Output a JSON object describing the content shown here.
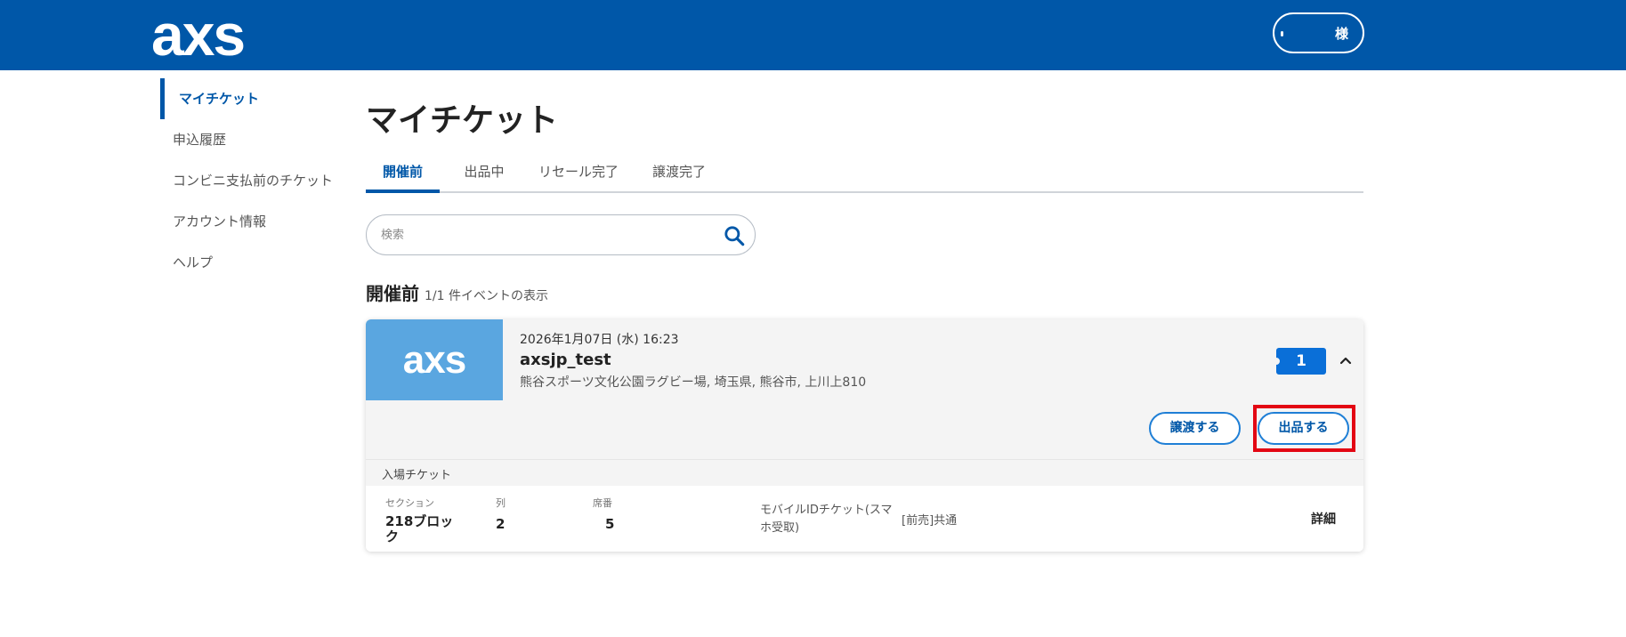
{
  "header": {
    "logo": "axs",
    "user_suffix": "様"
  },
  "sidebar": {
    "items": [
      {
        "label": "マイチケット"
      },
      {
        "label": "申込履歴"
      },
      {
        "label": "コンビニ支払前のチケット"
      },
      {
        "label": "アカウント情報"
      },
      {
        "label": "ヘルプ"
      }
    ]
  },
  "main": {
    "title": "マイチケット",
    "tabs": [
      {
        "label": "開催前"
      },
      {
        "label": "出品中"
      },
      {
        "label": "リセール完了"
      },
      {
        "label": "譲渡完了"
      }
    ],
    "search": {
      "placeholder": "検索"
    },
    "list": {
      "heading": "開催前",
      "count": "1/1 件イベントの表示"
    }
  },
  "event": {
    "thumb_logo": "axs",
    "date": "2026年1月07日 (水) 16:23",
    "name": "axsjp_test",
    "venue": "熊谷スポーツ文化公園ラグビー場, 埼玉県, 熊谷市, 上川上810",
    "ticket_count": "1",
    "buttons": {
      "transfer": "譲渡する",
      "sell": "出品する"
    },
    "section_header": "入場チケット",
    "ticket": {
      "labels": {
        "section": "セクション",
        "row": "列",
        "seat": "席番"
      },
      "section": "218ブロック",
      "row": "2",
      "seat": "5",
      "type": "モバイルIDチケット(スマホ受取)",
      "price_type": "[前売]共通",
      "detail": "詳細"
    }
  },
  "colors": {
    "brand": "#0057a8",
    "accent": "#1f7fd6",
    "highlight": "#e30613",
    "badge": "#0a6fd8"
  }
}
